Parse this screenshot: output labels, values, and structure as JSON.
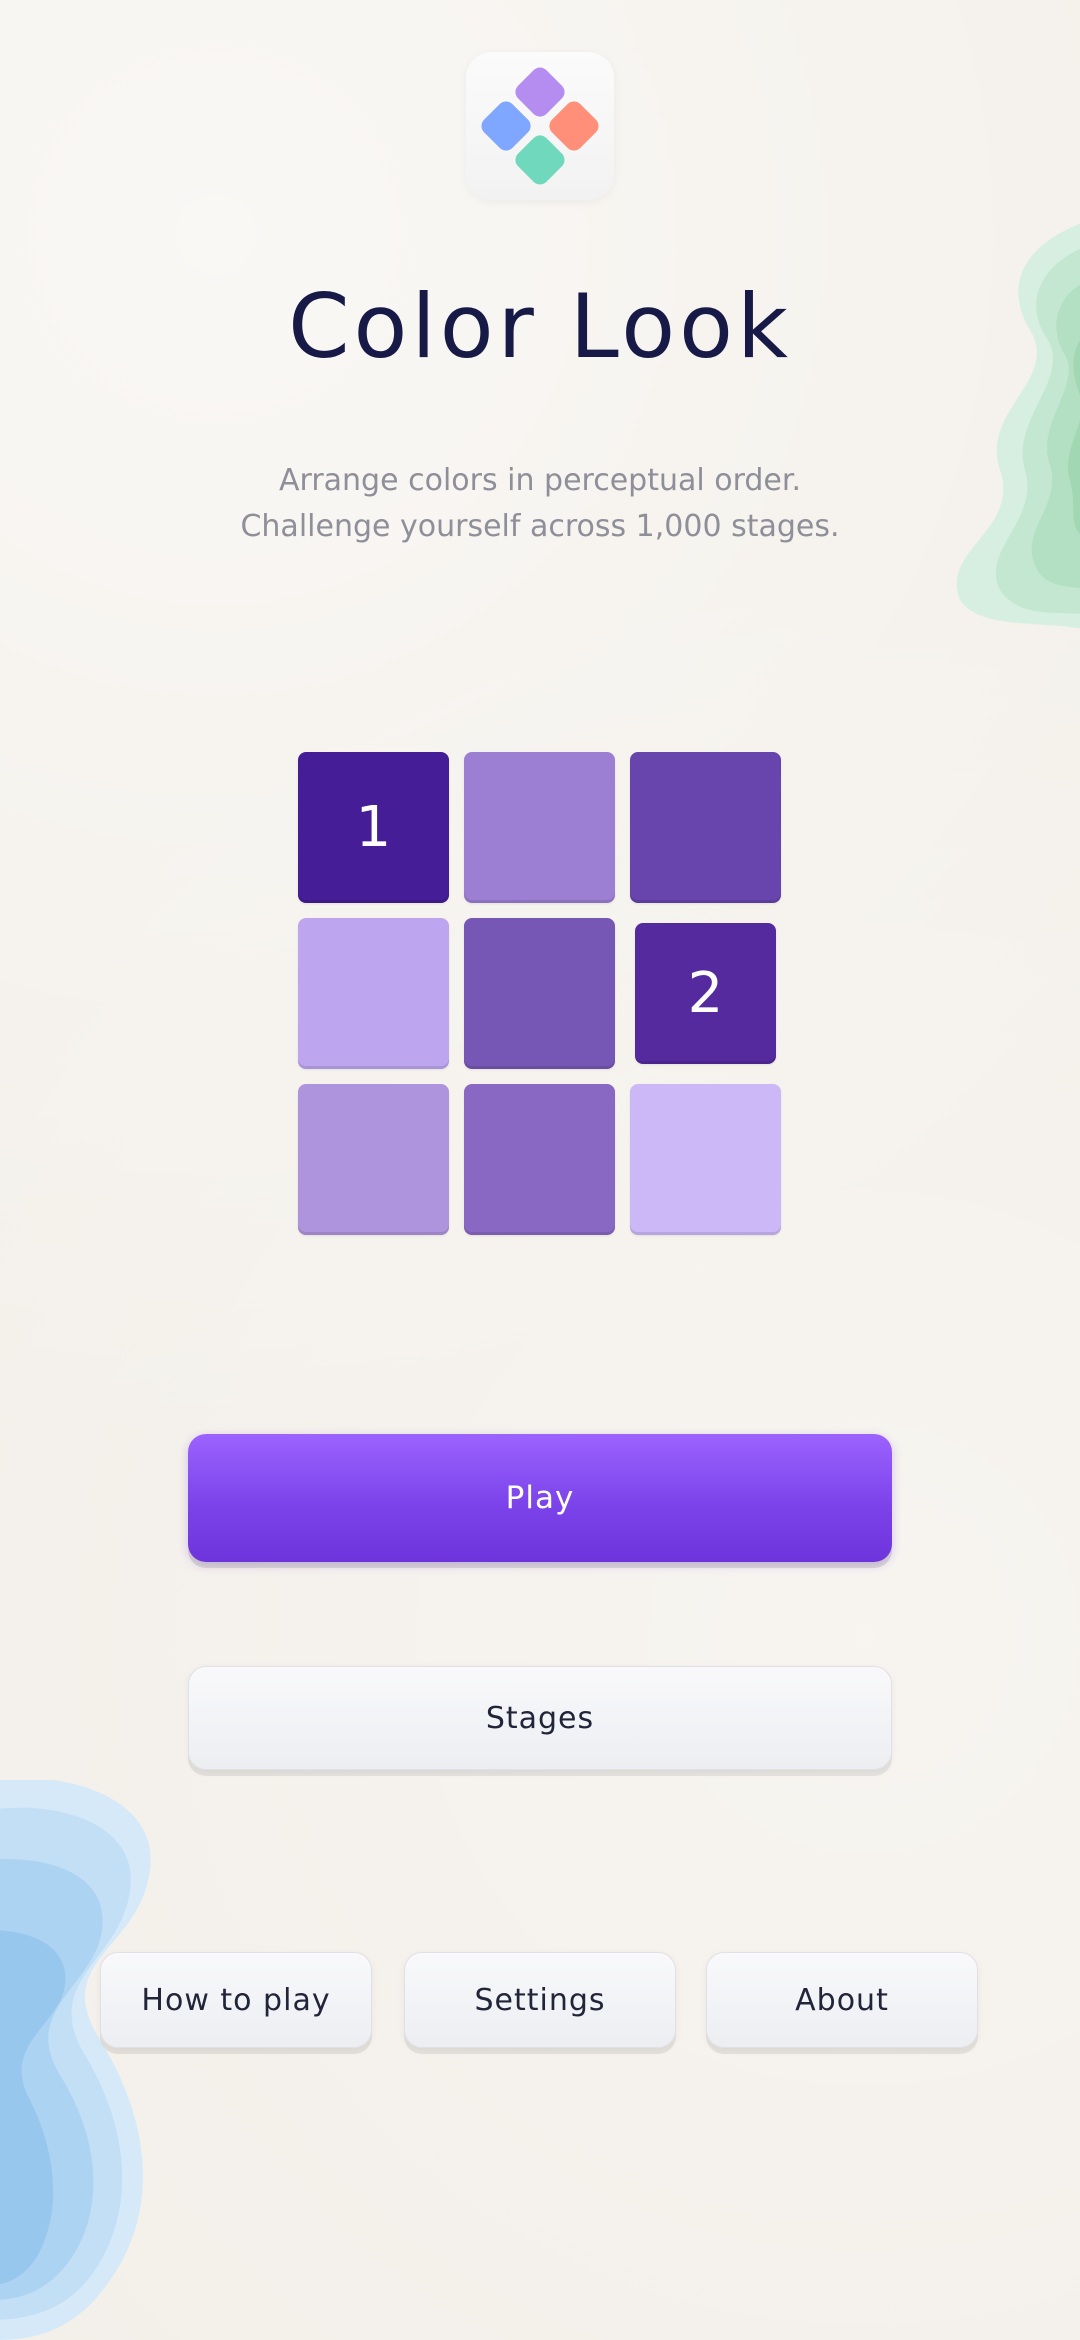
{
  "app": {
    "title": "Color Look",
    "subtitle_line1": "Arrange colors in perceptual order.",
    "subtitle_line2": "Challenge yourself across 1,000 stages."
  },
  "logo": {
    "icon": "diamond-tiles-logo-icon",
    "colors": [
      "#b58df0",
      "#ff8f79",
      "#7fa7ff",
      "#6fd8bd"
    ]
  },
  "puzzle_grid": {
    "rows": 3,
    "cols": 3,
    "tiles": [
      {
        "row": 0,
        "col": 0,
        "color": "#451d97",
        "label": "1",
        "selected": true
      },
      {
        "row": 0,
        "col": 1,
        "color": "#9c7fd2",
        "label": "",
        "selected": false
      },
      {
        "row": 0,
        "col": 2,
        "color": "#6845ac",
        "label": "",
        "selected": false
      },
      {
        "row": 1,
        "col": 0,
        "color": "#bda6ef",
        "label": "",
        "selected": false
      },
      {
        "row": 1,
        "col": 1,
        "color": "#7757b5",
        "label": "",
        "selected": false
      },
      {
        "row": 1,
        "col": 2,
        "color": "#552a9f",
        "label": "2",
        "selected": true
      },
      {
        "row": 2,
        "col": 0,
        "color": "#ae93dd",
        "label": "",
        "selected": false
      },
      {
        "row": 2,
        "col": 1,
        "color": "#8868c2",
        "label": "",
        "selected": false
      },
      {
        "row": 2,
        "col": 2,
        "color": "#ccb8f6",
        "label": "",
        "selected": false
      }
    ]
  },
  "buttons": {
    "play": "Play",
    "stages": "Stages",
    "how_to_play": "How to play",
    "settings": "Settings",
    "about": "About"
  },
  "colors": {
    "accent": "#7c43ea",
    "background": "#f3efe9",
    "title": "#171a46",
    "subtitle": "#8f8f99"
  }
}
